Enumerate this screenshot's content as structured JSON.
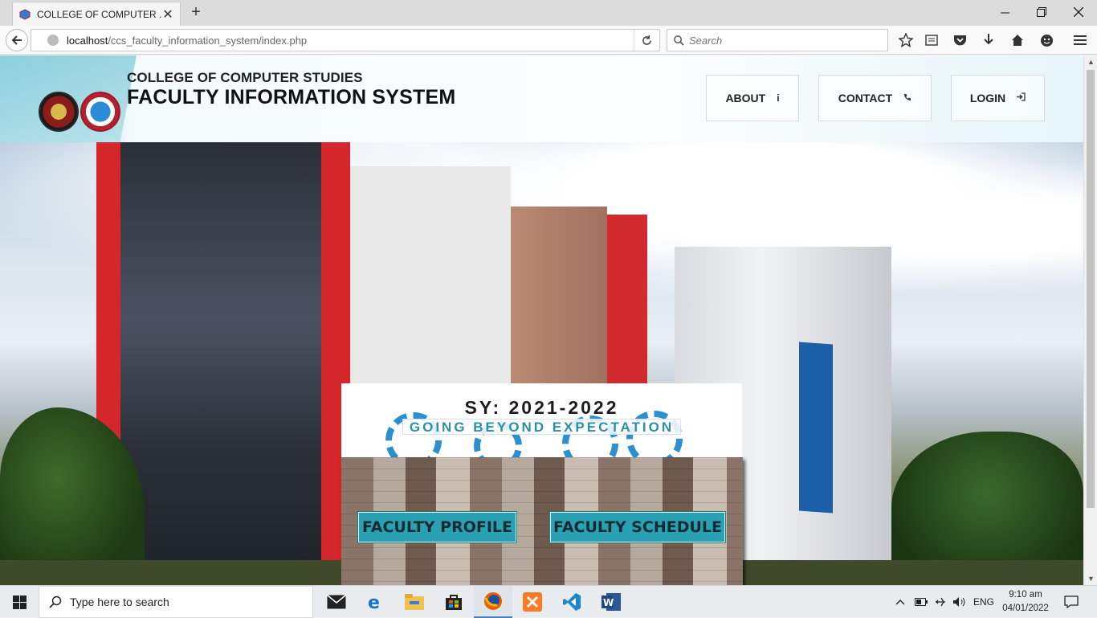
{
  "browser": {
    "tab_title": "COLLEGE OF COMPUTER ...",
    "url_host": "localhost",
    "url_path": "/ccs_faculty_information_system/index.php",
    "search_placeholder": "Search"
  },
  "header": {
    "subtitle": "COLLEGE OF COMPUTER STUDIES",
    "title": "FACULTY INFORMATION SYSTEM",
    "nav": [
      {
        "label": "ABOUT",
        "icon": "info-icon"
      },
      {
        "label": "CONTACT",
        "icon": "phone-icon"
      },
      {
        "label": "LOGIN",
        "icon": "sign-in-icon"
      }
    ]
  },
  "card": {
    "school_year": "SY: 2021-2022",
    "motto": "GOING BEYOND EXPECTATION",
    "buttons": {
      "profile": "FACULTY PROFILE",
      "schedule": "FACULTY SCHEDULE"
    }
  },
  "taskbar": {
    "search_placeholder": "Type here to search",
    "language": "ENG",
    "time": "9:10 am",
    "date": "04/01/2022"
  },
  "colors": {
    "accent_teal": "#2aa1b3",
    "brand_red": "#d4262b"
  }
}
